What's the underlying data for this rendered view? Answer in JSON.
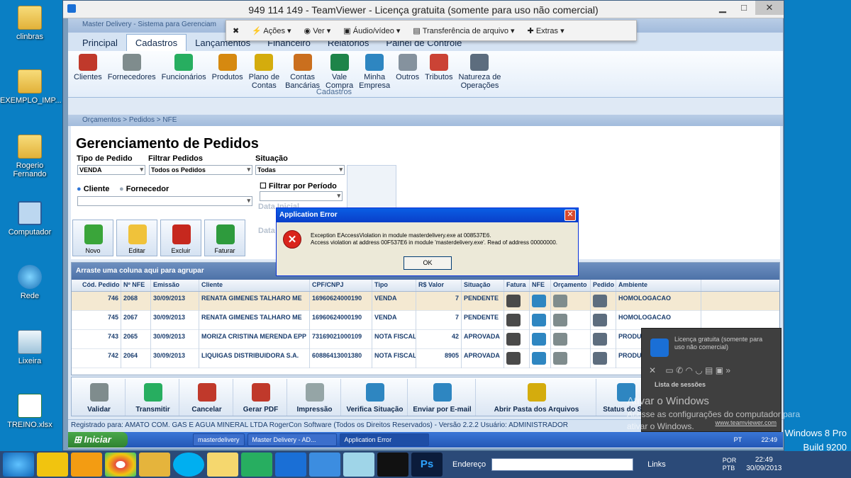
{
  "desktop": {
    "icons": [
      {
        "label": "clinbras",
        "icon": "folder-icon"
      },
      {
        "label": "EXEMPLO_IMP...",
        "icon": "folder-icon"
      },
      {
        "label": "Rogerio Fernando",
        "icon": "user-folder-icon"
      },
      {
        "label": "Computador",
        "icon": "computer-icon"
      },
      {
        "label": "Rede",
        "icon": "network-icon"
      },
      {
        "label": "Lixeira",
        "icon": "recycle-bin-icon"
      },
      {
        "label": "TREINO.xlsx",
        "icon": "excel-file-icon"
      }
    ],
    "windows_edition": "Windows 8 Pro",
    "windows_build": "Build 9200"
  },
  "teamviewer": {
    "title": "949 114 149 - TeamViewer - Licença gratuita (somente para uso não comercial)",
    "toolbar": [
      "Ações",
      "Ver",
      "Áudio/vídeo",
      "Transferência de arquivo",
      "Extras"
    ],
    "panel_text": "Licença gratuita (somente para uso não comercial)",
    "panel_sessions": "Lista de sessões",
    "panel_url": "www.teamviewer.com"
  },
  "app": {
    "title": "Master Delivery - Sistema para Gerenciam",
    "menu_tabs": [
      "Principal",
      "Cadastros",
      "Lançamentos",
      "Financeiro",
      "Relatórios",
      "Painel de Controle"
    ],
    "ribbon": [
      {
        "label": "Clientes",
        "color": "#c0392b"
      },
      {
        "label": "Fornecedores",
        "color": "#7f8c8d"
      },
      {
        "label": "Funcionários",
        "color": "#27ae60"
      },
      {
        "label": "Produtos",
        "color": "#d68910"
      },
      {
        "label": "Plano de\nContas",
        "color": "#d4ac0d"
      },
      {
        "label": "Contas\nBancárias",
        "color": "#ca6f1e"
      },
      {
        "label": "Vale\nCompra",
        "color": "#1e8449"
      },
      {
        "label": "Minha\nEmpresa",
        "color": "#2e86c1"
      },
      {
        "label": "Outros",
        "color": "#85929e"
      },
      {
        "label": "Tributos",
        "color": "#cb4335"
      },
      {
        "label": "Natureza de\nOperações",
        "color": "#5d6d7e"
      }
    ],
    "ribbon_group": "Cadastros",
    "breadcrumb": "Orçamentos > Pedidos > NFE",
    "form": {
      "title": "Gerenciamento de Pedidos",
      "tipo_label": "Tipo de Pedido",
      "tipo_value": "VENDA",
      "filtrar_label": "Filtrar Pedidos",
      "filtrar_value": "Todos os Pedidos",
      "situacao_label": "Situação",
      "situacao_value": "Todas",
      "cliente_label": "Cliente",
      "fornecedor_label": "Fornecedor",
      "periodo_label": "Filtrar por Período",
      "data_inicial": "Data Inicial",
      "data_final": "Data",
      "buttons": [
        "Novo",
        "Editar",
        "Excluir",
        "Faturar"
      ]
    },
    "grid": {
      "group_hint": "Arraste uma coluna aqui para agrupar",
      "columns": [
        "Cód. Pedido",
        "Nº NFE",
        "Emissão",
        "Cliente",
        "CPF/CNPJ",
        "Tipo",
        "R$ Valor",
        "Situação",
        "Fatura",
        "NFE",
        "Orçamento",
        "Pedido",
        "Ambiente"
      ],
      "rows": [
        {
          "cod": "746",
          "nfe": "2068",
          "emissao": "30/09/2013",
          "cliente": "RENATA GIMENES TALHARO ME",
          "cnpj": "16960624000190",
          "tipo": "VENDA",
          "valor": "7",
          "situacao": "PENDENTE",
          "ambiente": "HOMOLOGACAO"
        },
        {
          "cod": "745",
          "nfe": "2067",
          "emissao": "30/09/2013",
          "cliente": "RENATA GIMENES TALHARO ME",
          "cnpj": "16960624000190",
          "tipo": "VENDA",
          "valor": "7",
          "situacao": "PENDENTE",
          "ambiente": "HOMOLOGACAO"
        },
        {
          "cod": "743",
          "nfe": "2065",
          "emissao": "30/09/2013",
          "cliente": "MORIZA CRISTINA MERENDA EPP",
          "cnpj": "73169021000109",
          "tipo": "NOTA FISCAL",
          "valor": "42",
          "situacao": "APROVADA",
          "ambiente": "PRODU"
        },
        {
          "cod": "742",
          "nfe": "2064",
          "emissao": "30/09/2013",
          "cliente": "LIQUIGAS DISTRIBUIDORA S.A.",
          "cnpj": "60886413001380",
          "tipo": "NOTA FISCAL",
          "valor": "8905",
          "situacao": "APROVADA",
          "ambiente": "PRODU"
        }
      ]
    },
    "actions": [
      "Validar",
      "Transmitir",
      "Cancelar",
      "Gerar PDF",
      "Impressão",
      "Verifica Situação",
      "Enviar por E-mail",
      "Abrir Pasta dos Arquivos",
      "Status do Ser"
    ],
    "status": "Registrado para: AMATO COM. GAS E AGUA MINERAL LTDA   RogerCon Software (Todos os Direitos Reservados) - Versão 2.2.2    Usuário: ADMINISTRADOR"
  },
  "dialog": {
    "title": "Application Error",
    "line1": "Exception EAccessViolation in module masterdelivery.exe at 008537E6.",
    "line2": "Access violation at address 00F537E6 in module 'masterdelivery.exe'. Read of address 00000000.",
    "ok": "OK"
  },
  "remote_taskbar": {
    "start": "Iniciar",
    "items": [
      "masterdelivery",
      "Master Delivery - AD...",
      "Application Error"
    ],
    "lang": "PT",
    "time": "22:49"
  },
  "win8_taskbar": {
    "address_label": "Endereço",
    "links_label": "Links",
    "lang": "POR\nPTB",
    "time": "22:49",
    "date": "30/09/2013"
  },
  "watermark": {
    "line1": "Ativar o Windows",
    "line2": "Acesse as configurações do computador para",
    "line3": "ativar o Windows."
  }
}
